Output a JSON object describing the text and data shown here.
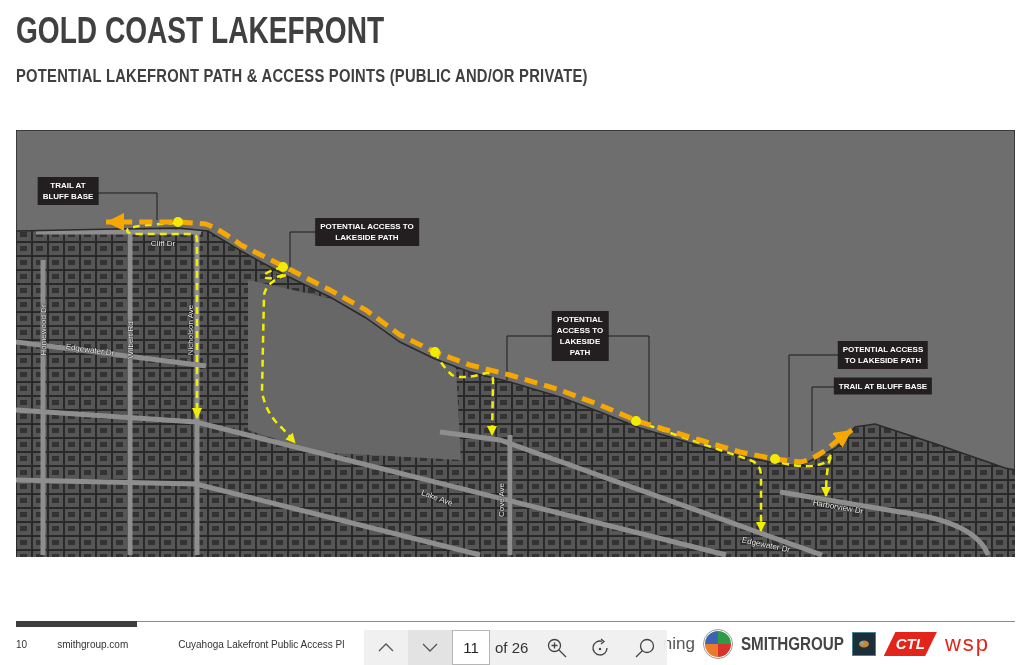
{
  "title": "GOLD COAST LAKEFRONT",
  "subtitle": "POTENTIAL LAKEFRONT PATH & ACCESS POINTS (PUBLIC AND/OR PRIVATE)",
  "map": {
    "callouts": [
      {
        "lines": [
          "TRAIL AT",
          "BLUFF BASE"
        ]
      },
      {
        "lines": [
          "POTENTIAL ACCESS TO",
          "LAKESIDE PATH"
        ]
      },
      {
        "lines": [
          "POTENTIAL",
          "ACCESS TO",
          "LAKESIDE",
          "PATH"
        ]
      },
      {
        "lines": [
          "POTENTIAL ACCESS",
          "TO LAKESIDE PATH"
        ]
      },
      {
        "lines": [
          "TRAIL AT BLUFF BASE"
        ]
      }
    ],
    "street_labels": [
      "Cliff Dr",
      "Homewood Dr",
      "Edgewater Dr",
      "Wilbert Rd",
      "Nicholson Ave",
      "Lake Ave",
      "Cove Ave",
      "Harborview Dr",
      "Edgewater Dr"
    ]
  },
  "footer": {
    "page_number": "10",
    "website": "smithgroup.com",
    "document_title": "Cuyahoga Lakefront Public Access Pl",
    "logos": [
      {
        "kind": "text",
        "text": "ning"
      },
      {
        "kind": "emblem"
      },
      {
        "kind": "wordmark",
        "text": "SMITHGROUP",
        "color": "#454545"
      },
      {
        "kind": "square"
      },
      {
        "kind": "badge",
        "text": "CTL"
      },
      {
        "kind": "wordmark",
        "text": "wsp",
        "color": "#e3241b"
      }
    ]
  },
  "viewer_toolbar": {
    "nav_buttons": [
      {
        "kind": "up",
        "highlighted": false
      },
      {
        "kind": "down",
        "highlighted": true
      }
    ],
    "page_input": {
      "value": "11"
    },
    "page_count": "of 26",
    "tools": [
      {
        "kind": "zoom-in"
      },
      {
        "kind": "rotate"
      },
      {
        "kind": "search"
      }
    ]
  }
}
